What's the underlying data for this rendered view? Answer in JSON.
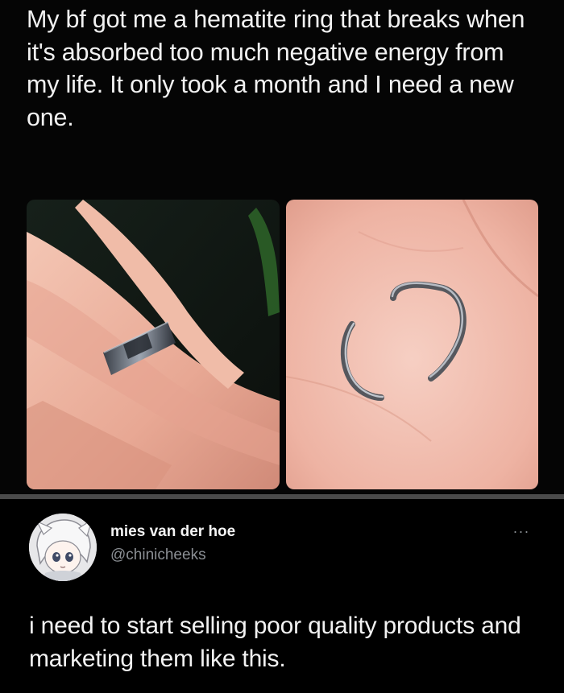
{
  "post": {
    "text": "My bf got me a hematite ring that breaks when it's absorbed too much negative energy from my life. It only took a month and I need a new one."
  },
  "reply": {
    "author_name": "mies van der hoe",
    "author_handle": "@chinicheeks",
    "more_icon": "more-options-icon",
    "more_label": "···",
    "text": "i need to start selling poor quality products and marketing them like this."
  },
  "colors": {
    "background": "#000000",
    "text_primary": "#f2f2f2",
    "text_secondary": "#8b8f94",
    "divider": "#4a4a4a"
  }
}
